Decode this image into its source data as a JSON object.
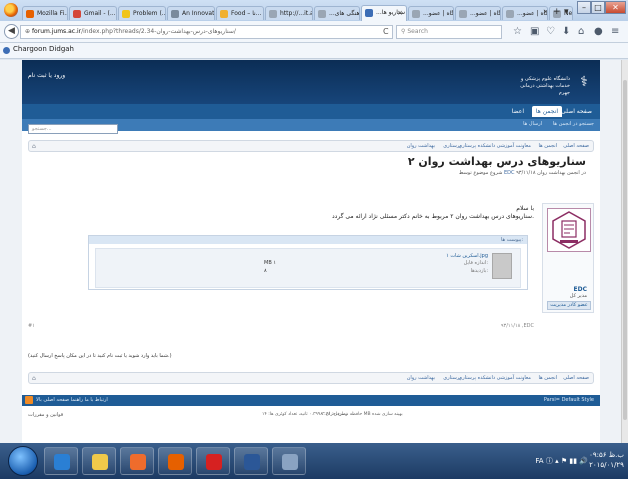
{
  "browser": {
    "tabs": [
      {
        "label": "Mozilla Fi...",
        "color": "#e66000"
      },
      {
        "label": "Gmail - (...",
        "color": "#d44638"
      },
      {
        "label": "Problem (...",
        "color": "#f0c419"
      },
      {
        "label": "An Innovative...",
        "color": "#7a8a9c"
      },
      {
        "label": "Food – نا...",
        "color": "#f0b030"
      },
      {
        "label": "http://...it.aspx",
        "color": "#9aa6b4"
      },
      {
        "label": "...هماهنگی های",
        "color": "#9aa6b4"
      },
      {
        "label": "...سناریو ها",
        "color": "#3c6db5"
      },
      {
        "label": "...دانشگاه | عضو",
        "color": "#9aa6b4"
      },
      {
        "label": "...دانشگاه | عضو",
        "color": "#9aa6b4"
      },
      {
        "label": "...دانشگاه | عضو",
        "color": "#9aa6b4"
      },
      {
        "label": "New",
        "color": "#9aa6b4"
      }
    ],
    "active_tab_index": 7,
    "tab_close": "×",
    "tab_scroll": "›",
    "tab_new": "+",
    "tab_list": "▾",
    "url_domain": "forum.jums.ac.ir",
    "url_path": "/index.php?threads/2.34-سناریوهای-درس-بهداشت-روان/",
    "search_placeholder": "Search",
    "bookmark": "Chargoon Didgah"
  },
  "site": {
    "login_link": "ورود یا ثبت نام",
    "uni_name": "دانشگاه علوم پزشکی و خدمات بهداشتی درمانی جهرم",
    "menu": {
      "home": "صفحه اصلی",
      "forums": "انجمن ها",
      "members": "اعضا"
    },
    "submenu": {
      "search": "جستجو در انجمن ها",
      "recent": "ارسال ها"
    },
    "search_placeholder": "جستجو...",
    "breadcrumbs": [
      "صفحه اصلی",
      "انجمن ها",
      "معاونت آموزشی دانشکده پرستاری",
      "پرستاری",
      "بهداشت روان"
    ],
    "thread_title": "سناریوهای درس بهداشت روان ۲",
    "started_prefix": "شروع موضوع توسط",
    "started_user": "EDC",
    "started_date": "۹۳/۱۱/۱۸",
    "started_suffix": "در انجمن بهداشت روان",
    "post": {
      "greeting": "با سلام",
      "message": "سناریوهای درس بهداشت روان ۲ مربوط به خانم دکتر مسئلی نژاد ارائه می گردد.",
      "attach_header": "پیوست ها:",
      "file_name": "اسکرین شات ۱.jpg",
      "file_size": "MB ۱",
      "file_views": "بازدیدها:",
      "file_views_count": "۸",
      "file_type": "اندازه فایل:",
      "username": "EDC",
      "user_title": "مدیر کل",
      "user_button": "عضو کادر مدیریت",
      "date": "۹۳/۱۱/۱۸ ,EDC",
      "number": "#۱"
    },
    "permissions": "(شما باید وارد شوید یا ثبت نام کنید تا در این مکان پاسخ ارسال کنید.)",
    "bottombar": {
      "left": "ارتباط با ما   راهنما   صفحه اصلی   بالا",
      "right": "Parsi=  Default Style"
    },
    "footer": {
      "left": "قوانین و مقررات",
      "center": "زمان اجرای: ۰.۳۹۹۸ ثانیه، تعداد کوئری ها: ۱۴",
      "right": "حافظه مصرفی: ۳.۳۱ MB بهینه سازی شده"
    }
  },
  "taskbar": {
    "apps": [
      {
        "name": "ie",
        "color": "#2a7fd4"
      },
      {
        "name": "explorer",
        "color": "#f0c94a"
      },
      {
        "name": "media",
        "color": "#ef6c2c"
      },
      {
        "name": "firefox",
        "color": "#e66000"
      },
      {
        "name": "acrobat",
        "color": "#d62121"
      },
      {
        "name": "word",
        "color": "#2b5797"
      },
      {
        "name": "calculator",
        "color": "#8aa3c2"
      }
    ],
    "lang": "FA",
    "time": "۰۹:۵۶ ب.ظ",
    "date": "۲۰۱۵/۰۱/۲۹"
  }
}
